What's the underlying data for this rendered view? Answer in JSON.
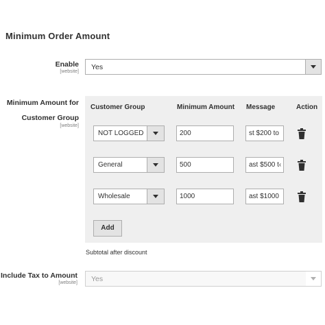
{
  "section": {
    "title": "Minimum Order Amount"
  },
  "enable": {
    "label": "Enable",
    "scope": "[website]",
    "value": "Yes"
  },
  "customer_group_amount": {
    "label_line1": "Minimum Amount for",
    "label_line2": "Customer Group",
    "scope": "[website]",
    "columns": [
      "Customer Group",
      "Minimum Amount",
      "Message",
      "Action"
    ],
    "rows": [
      {
        "group": "NOT LOGGED",
        "amount": "200",
        "message": "st $200 to"
      },
      {
        "group": "General",
        "amount": "500",
        "message": "ast $500 t‹"
      },
      {
        "group": "Wholesale",
        "amount": "1000",
        "message": "ast $1000"
      }
    ],
    "add_label": "Add",
    "note": "Subtotal after discount"
  },
  "include_tax": {
    "label": "Include Tax to Amount",
    "scope": "[website]",
    "value": "Yes"
  },
  "icons": {
    "dropdown": "chevron-down-icon",
    "delete": "trash-icon"
  }
}
